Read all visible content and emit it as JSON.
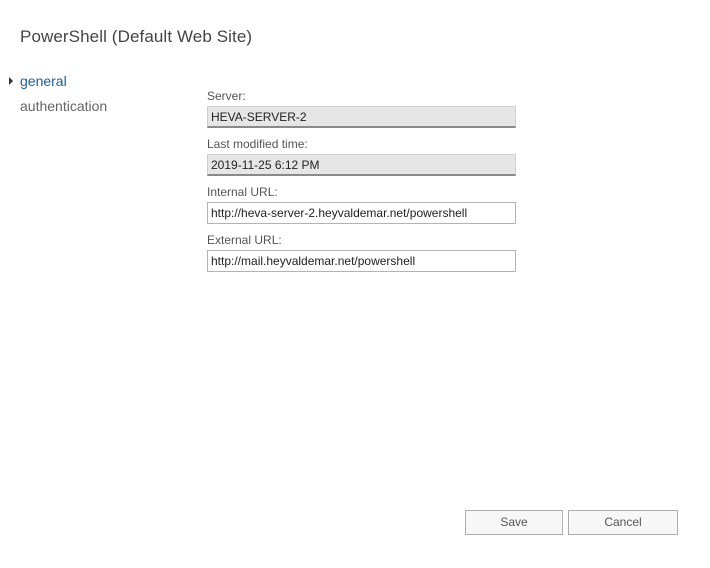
{
  "window": {
    "title": "PowerShell (Default Web Site)"
  },
  "nav": {
    "items": [
      {
        "label": "general",
        "active": true
      },
      {
        "label": "authentication",
        "active": false
      }
    ]
  },
  "form": {
    "server": {
      "label": "Server:",
      "value": "HEVA-SERVER-2"
    },
    "last_modified": {
      "label": "Last modified time:",
      "value": "2019-11-25 6:12 PM"
    },
    "internal_url": {
      "label": "Internal URL:",
      "value": "http://heva-server-2.heyvaldemar.net/powershell"
    },
    "external_url": {
      "label": "External URL:",
      "value": "http://mail.heyvaldemar.net/powershell"
    }
  },
  "buttons": {
    "save_label": "Save",
    "cancel_label": "Cancel"
  },
  "colors": {
    "active_nav": "#1a5e99",
    "readonly_field_bg": "#e6e6e6"
  },
  "icons": {
    "selected_nav_marker": "triangle-right-icon"
  }
}
